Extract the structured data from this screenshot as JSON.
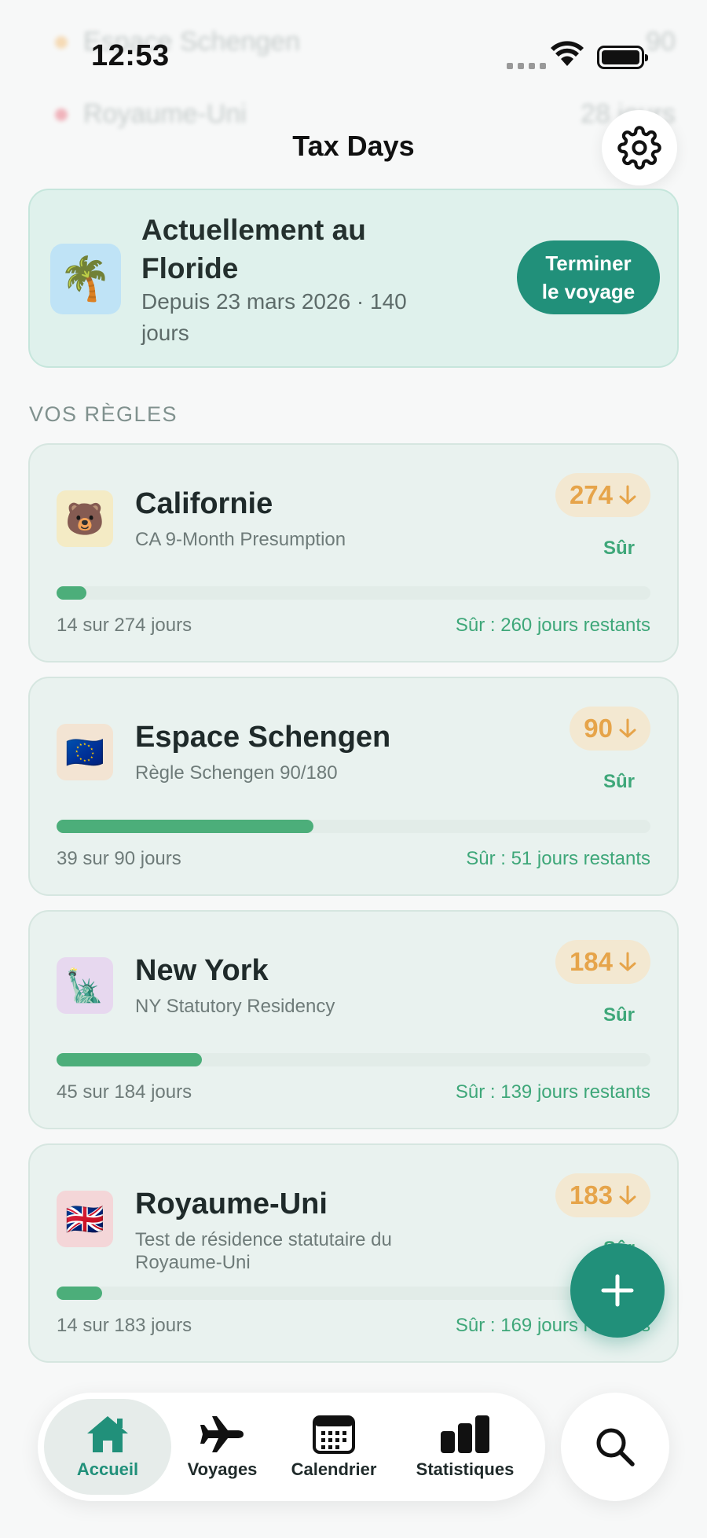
{
  "status_bar": {
    "time": "12:53"
  },
  "ghost_rows": [
    {
      "name": "Espace Schengen",
      "value": "90"
    },
    {
      "name": "Royaume-Uni",
      "value": "28 jours"
    }
  ],
  "header": {
    "title": "Tax Days",
    "settings_icon": "gear-icon"
  },
  "current_trip": {
    "icon": "🌴",
    "title": "Actuellement au Floride",
    "subtitle": "Depuis 23 mars 2026 · 140 jours",
    "end_button": "Terminer\nle voyage"
  },
  "rules_section": {
    "title": "VOS RÈGLES"
  },
  "rules": [
    {
      "icon": "🐻",
      "icon_bg": "#f4ebc5",
      "name": "Californie",
      "description": "CA 9-Month Presumption",
      "limit": "274",
      "status": "Sûr",
      "count": "14 sur 274 jours",
      "remaining": "Sûr : 260 jours restants",
      "progress": 0.05
    },
    {
      "icon": "🇪🇺",
      "icon_bg": "#f3e4d3",
      "name": "Espace Schengen",
      "description": "Règle Schengen 90/180",
      "limit": "90",
      "status": "Sûr",
      "count": "39 sur 90 jours",
      "remaining": "Sûr : 51 jours restants",
      "progress": 0.433
    },
    {
      "icon": "🗽",
      "icon_bg": "#e7d8ef",
      "name": "New York",
      "description": "NY Statutory Residency",
      "limit": "184",
      "status": "Sûr",
      "count": "45 sur 184 jours",
      "remaining": "Sûr : 139 jours restants",
      "progress": 0.245
    },
    {
      "icon": "🇬🇧",
      "icon_bg": "#f4d6d8",
      "name": "Royaume-Uni",
      "description": "Test de résidence statutaire du Royaume-Uni",
      "limit": "183",
      "status": "Sûr",
      "count": "14 sur 183 jours",
      "remaining": "Sûr : 169 jours restants",
      "progress": 0.077
    }
  ],
  "fab": {
    "icon": "plus-icon"
  },
  "tabs": [
    {
      "label": "Accueil",
      "icon": "home-icon",
      "active": true
    },
    {
      "label": "Voyages",
      "icon": "airplane-icon",
      "active": false
    },
    {
      "label": "Calendrier",
      "icon": "calendar-icon",
      "active": false
    },
    {
      "label": "Statistiques",
      "icon": "bar-chart-icon",
      "active": false
    }
  ],
  "search": {
    "icon": "search-icon"
  },
  "colors": {
    "accent": "#21907a",
    "safe": "#3ea779",
    "warning": "#e6a44a",
    "card_bg": "#e9f2ef"
  }
}
